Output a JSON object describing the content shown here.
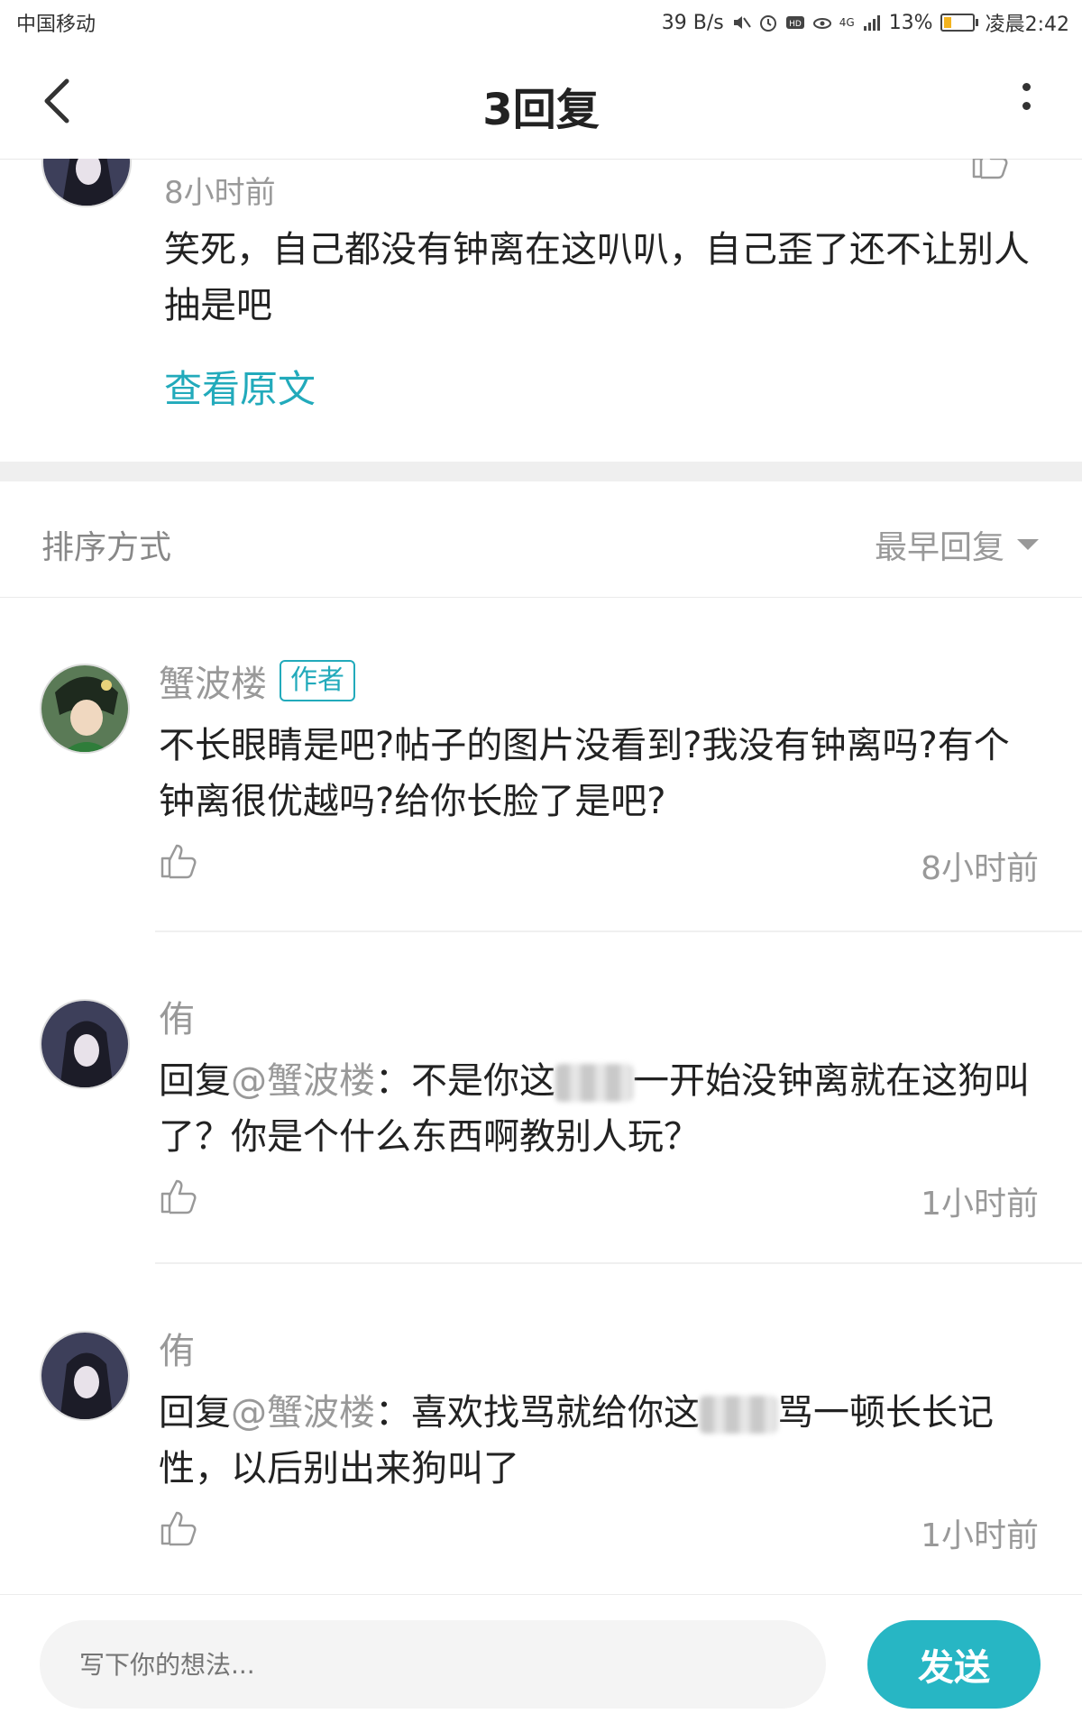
{
  "status_bar": {
    "carrier": "中国移动",
    "speed": "39 B/s",
    "network": "4G",
    "battery": "13%",
    "time": "凌晨2:42"
  },
  "header": {
    "title": "3回复"
  },
  "parent_comment": {
    "time": "8小时前",
    "content": "笑死，自己都没有钟离在这叭叭，自己歪了还不让别人抽是吧",
    "view_original": "查看原文"
  },
  "sort": {
    "label": "排序方式",
    "selected": "最早回复"
  },
  "replies": [
    {
      "username": "蟹波楼",
      "badge": "作者",
      "content": "不长眼睛是吧?帖子的图片没看到?我没有钟离吗?有个钟离很优越吗?给你长脸了是吧?",
      "time": "8小时前"
    },
    {
      "username": "侑",
      "reply_prefix": "回复",
      "reply_target": "@蟹波楼",
      "content_before": "：不是你这",
      "content_after": "一开始没钟离就在这狗叫了？你是个什么东西啊教别人玩？",
      "time": "1小时前"
    },
    {
      "username": "侑",
      "reply_prefix": "回复",
      "reply_target": "@蟹波楼",
      "content_before": "：喜欢找骂就给你这",
      "content_after": "骂一顿长长记性，以后别出来狗叫了",
      "time": "1小时前"
    }
  ],
  "input": {
    "placeholder": "写下你的想法...",
    "send_label": "发送"
  },
  "colors": {
    "accent": "#27b6c4",
    "link": "#22aabb"
  }
}
